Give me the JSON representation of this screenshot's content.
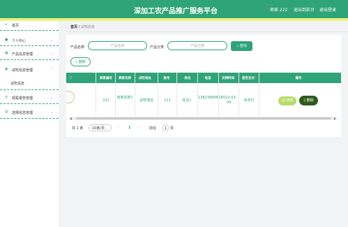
{
  "header": {
    "title": "深加工农产品推广服务平台",
    "user": "商家 222",
    "exit_backend": "退出到前台",
    "logout": "退出登录"
  },
  "sidebar": {
    "items": [
      {
        "label": "首页",
        "icon": "home-icon"
      },
      {
        "label": "个人中心",
        "icon": "user-icon"
      },
      {
        "label": "产品信息管理",
        "icon": "grid-icon"
      },
      {
        "label": "试吃信息管理",
        "icon": "pin-icon"
      },
      {
        "label": "试吃信息",
        "icon": ""
      },
      {
        "label": "观看报告管理",
        "icon": "check-circle-icon"
      },
      {
        "label": "选择信息管理",
        "icon": "doc-icon"
      }
    ]
  },
  "breadcrumb": {
    "home": "首页",
    "sep": "/",
    "current": "试吃信息"
  },
  "search": {
    "product_name_label": "产品名称",
    "product_name_placeholder": "产品名称",
    "category_label": "产品分类",
    "category_placeholder": "产品分类",
    "search_button": "查询"
  },
  "actions": {
    "delete_button": "删除"
  },
  "table": {
    "headers": [
      "商家编号",
      "商家名称",
      "试吃地址",
      "账号",
      "姓名",
      "电话",
      "交网时间",
      "是否支付",
      "操作"
    ],
    "rows": [
      {
        "merchant_no": "222",
        "merchant_name": "商家名称1",
        "address": "试吃地址",
        "account": "111",
        "name": "姓名1",
        "phone": "13823888881",
        "time": "2022-03-04",
        "paid": "未支付",
        "detail_button": "详情",
        "delete_button": "删除"
      }
    ]
  },
  "pagination": {
    "total": "共 1 条",
    "page_size": "10条/页",
    "current_page": "1",
    "goto_label": "前往",
    "goto_value": "1",
    "page_suffix": "页"
  },
  "colors": {
    "primary": "#2fa37a",
    "header_stripe": "#eef27a",
    "detail": "#b7dc6a",
    "danger": "#2d5a1e"
  }
}
